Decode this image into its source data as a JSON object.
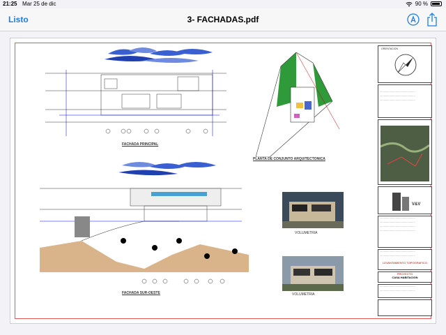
{
  "status": {
    "time": "21:25",
    "date": "Mar 25 de dic",
    "battery": "90 %",
    "battery_level": 0.9
  },
  "nav": {
    "done_label": "Listo",
    "title": "3- FACHADAS.pdf"
  },
  "icons": {
    "wifi": "wifi-icon",
    "battery": "battery-icon",
    "markup": "markup-pen-icon",
    "share": "share-icon"
  },
  "drawing": {
    "fachada_principal": "FACHADA PRINCIPAL",
    "planta_conjunto": "PLANTA DE CONJUNTO ARQUITECTONICA",
    "fachada_sur_oeste": "FACHADA SUR-OESTE",
    "volumetria_1": "VOLUMETRIA",
    "volumetria_2": "VOLUMETRIA",
    "titleblock": {
      "orientacion": "ORIENTACION",
      "logo": "V&V",
      "levantamiento": "LEVANTAMIENTO TOPOGRAFICO",
      "proyecto_label": "PROYECTO",
      "proyecto_value": "CASA HABITACION"
    }
  },
  "colors": {
    "accent": "#1a7ee6",
    "frame": "#e05a5a",
    "clouds": "#3a5fd0",
    "terrain": "#d9b48a",
    "green_area": "#2e9a3a"
  }
}
